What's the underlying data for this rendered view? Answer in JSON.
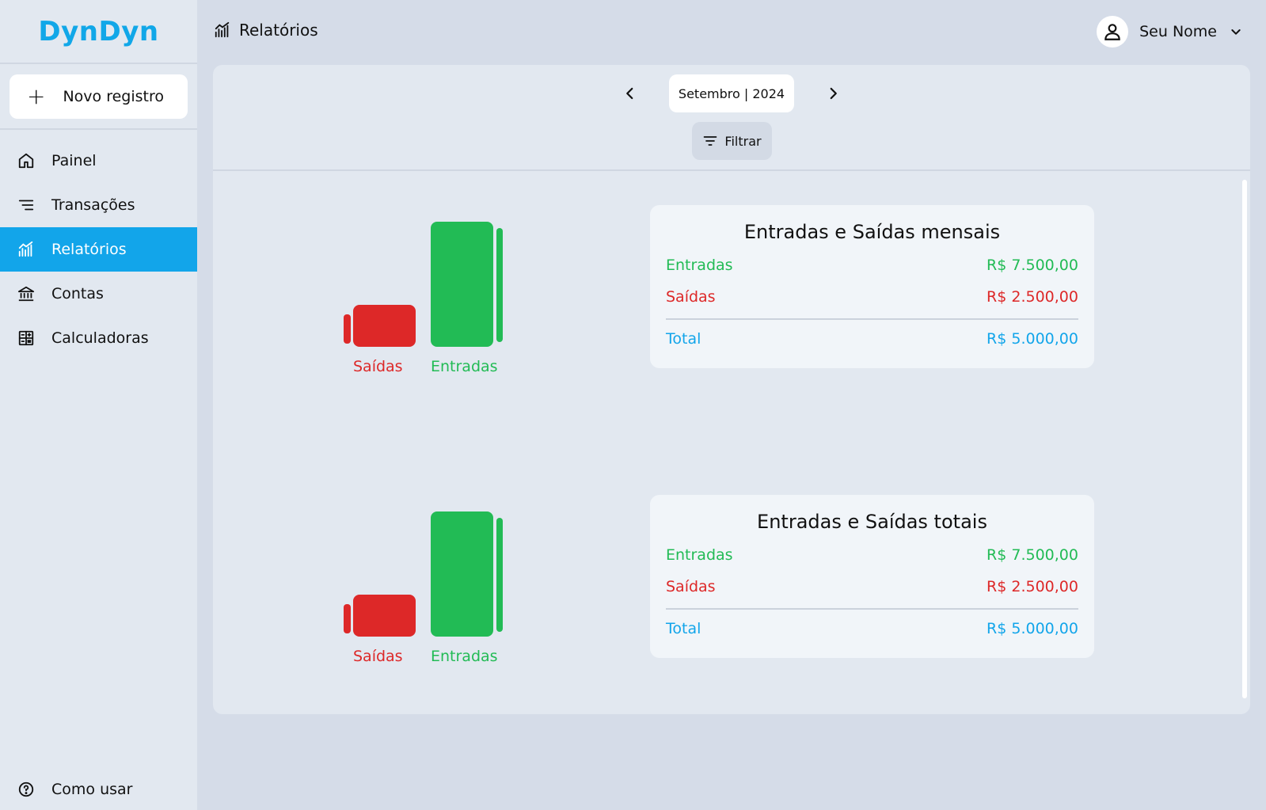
{
  "app": {
    "logo": "DynDyn"
  },
  "sidebar": {
    "new_button": "Novo registro",
    "items": [
      {
        "label": "Painel",
        "icon": "home-icon"
      },
      {
        "label": "Transações",
        "icon": "list-icon"
      },
      {
        "label": "Relatórios",
        "icon": "chart-icon",
        "active": true
      },
      {
        "label": "Contas",
        "icon": "bank-icon"
      },
      {
        "label": "Calculadoras",
        "icon": "calculator-icon"
      }
    ],
    "help": "Como usar"
  },
  "header": {
    "title": "Relatórios",
    "user_name": "Seu Nome"
  },
  "period": {
    "label": "Setembro | 2024"
  },
  "filter": {
    "label": "Filtrar"
  },
  "colors": {
    "accent": "#12a5ea",
    "income": "#22bb55",
    "expense": "#dd2828",
    "total": "#12a5ea"
  },
  "chart_data": [
    {
      "type": "bar",
      "categories": [
        "Saídas",
        "Entradas"
      ],
      "values": [
        2500,
        7500
      ]
    },
    {
      "type": "bar",
      "categories": [
        "Saídas",
        "Entradas"
      ],
      "values": [
        2500,
        7500
      ]
    }
  ],
  "cards": [
    {
      "title": "Entradas e Saídas mensais",
      "income_label": "Entradas",
      "income_value": "R$ 7.500,00",
      "expense_label": "Saídas",
      "expense_value": "R$ 2.500,00",
      "total_label": "Total",
      "total_value": "R$ 5.000,00"
    },
    {
      "title": "Entradas e Saídas totais",
      "income_label": "Entradas",
      "income_value": "R$ 7.500,00",
      "expense_label": "Saídas",
      "expense_value": "R$ 2.500,00",
      "total_label": "Total",
      "total_value": "R$ 5.000,00"
    }
  ]
}
